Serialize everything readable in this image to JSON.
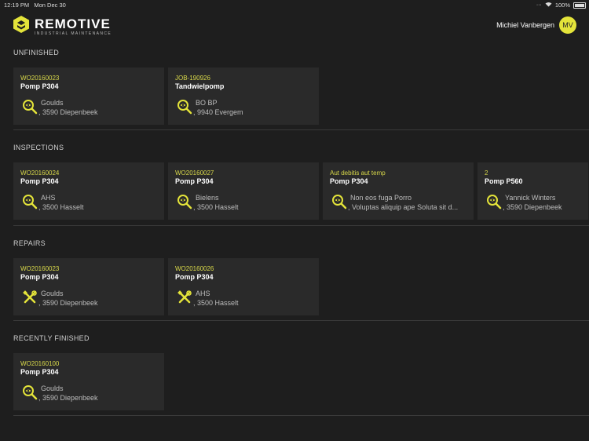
{
  "status": {
    "time": "12:19 PM",
    "date": "Mon Dec 30",
    "battery": "100%"
  },
  "app": {
    "name": "REMOTIVE",
    "tagline": "INDUSTRIAL MAINTENANCE"
  },
  "user": {
    "name": "Michiel Vanbergen",
    "initials": "MV"
  },
  "colors": {
    "accent": "#e4e43a",
    "background": "#1e1e1e",
    "card": "#2a2a2a"
  },
  "sections": [
    {
      "title": "UNFINISHED",
      "cards": [
        {
          "code": "WO20160023",
          "title": "Pomp P304",
          "icon": "inspect-icon",
          "line1": "Goulds",
          "line2": ", 3590 Diepenbeek"
        },
        {
          "code": "JOB-190926",
          "title": "Tandwielpomp",
          "icon": "inspect-icon",
          "line1": "BO BP",
          "line2": ", 9940 Evergem"
        }
      ]
    },
    {
      "title": "INSPECTIONS",
      "cards": [
        {
          "code": "WO20160024",
          "title": "Pomp P304",
          "icon": "inspect-icon",
          "line1": "AHS",
          "line2": ", 3500 Hasselt"
        },
        {
          "code": "WO20160027",
          "title": "Pomp P304",
          "icon": "inspect-icon",
          "line1": "Bielens",
          "line2": ", 3500 Hasselt"
        },
        {
          "code": "Aut debitis aut temp",
          "title": "Pomp P304",
          "icon": "inspect-icon",
          "line1": "Non eos fuga Porro",
          "line2": ", Voluptas aliquip ape Soluta sit d..."
        },
        {
          "code": "2",
          "title": "Pomp P560",
          "icon": "inspect-icon",
          "line1": "Yannick Winters",
          "line2": ", 3590 Diepenbeek"
        }
      ]
    },
    {
      "title": "REPAIRS",
      "cards": [
        {
          "code": "WO20160023",
          "title": "Pomp P304",
          "icon": "repair-icon",
          "line1": "Goulds",
          "line2": ", 3590 Diepenbeek"
        },
        {
          "code": "WO20160026",
          "title": "Pomp P304",
          "icon": "repair-icon",
          "line1": "AHS",
          "line2": ", 3500 Hasselt"
        }
      ]
    },
    {
      "title": "RECENTLY FINISHED",
      "cards": [
        {
          "code": "WO20160100",
          "title": "Pomp P304",
          "icon": "inspect-icon",
          "line1": "Goulds",
          "line2": ", 3590 Diepenbeek"
        }
      ]
    }
  ]
}
